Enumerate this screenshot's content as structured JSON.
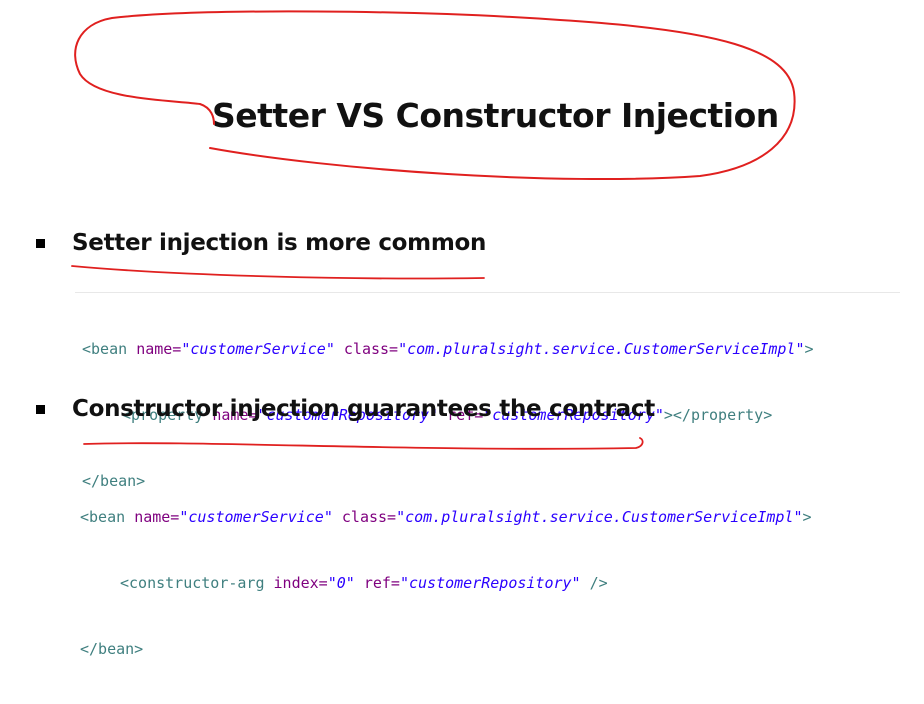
{
  "slide": {
    "title": "Setter VS Constructor Injection",
    "ink_color": "#e0201f",
    "bullets": [
      {
        "text": "Setter injection is more common",
        "code": {
          "l1": {
            "open": "<bean ",
            "a1": "name=",
            "v1": "\"customerService\"",
            "a2": " class=",
            "v2": "\"com.pluralsight.service.CustomerServiceImpl\"",
            "close": ">"
          },
          "l2": {
            "open": "<property ",
            "a1": "name=",
            "v1": "\"customerRepository\"",
            "a2": " ref=",
            "v2": "\"customerRepository\"",
            "close": "></property>"
          },
          "l3": "</bean>"
        }
      },
      {
        "text": "Constructor injection guarantees the contract",
        "code": {
          "l1": {
            "open": "<bean ",
            "a1": "name=",
            "v1": "\"customerService\"",
            "a2": " class=",
            "v2": "\"com.pluralsight.service.CustomerServiceImpl\"",
            "close": ">"
          },
          "l2": {
            "open": "<constructor-arg ",
            "a1": "index=",
            "v1": "\"0\"",
            "a2": " ref=",
            "v2": "\"customerRepository\"",
            "close": " />"
          },
          "l3": "</bean>"
        }
      }
    ]
  }
}
